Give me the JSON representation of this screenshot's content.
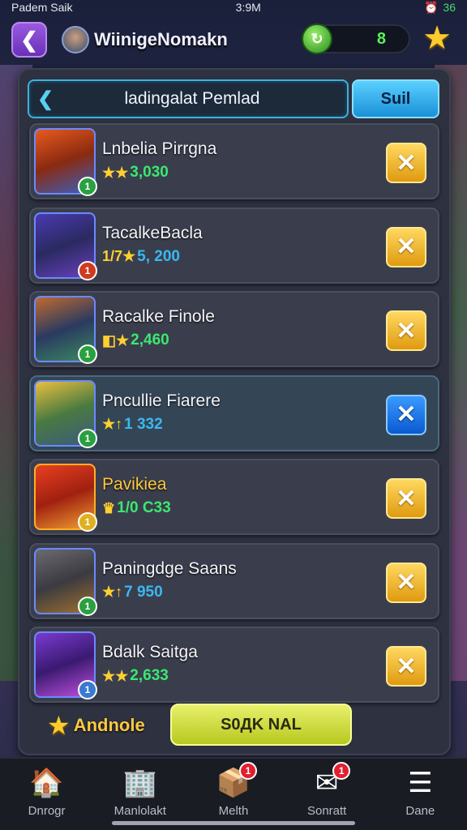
{
  "status_bar": {
    "carrier": "Padem Saik",
    "time": "3:9M",
    "right": "36"
  },
  "header": {
    "title": "WiinigeNomakn",
    "coins": "8"
  },
  "search": {
    "value": "ladingalat Pemlad",
    "button_label": "Suil"
  },
  "items": [
    {
      "name": "Lnbelia Pirrgna",
      "stat": "3,030",
      "badge": "1",
      "badge_color": "#2aa040",
      "stat_color": "#3ae870",
      "stat_icon": "★★",
      "avatar_bg": "linear-gradient(160deg,#e85a20,#8a2a10 50%,#3a60c0)",
      "action": "gold",
      "frame": "blue"
    },
    {
      "name": "TacalkeBacla",
      "stat": "5, 200",
      "badge": "1",
      "badge_color": "#d03a20",
      "stat_color": "#3ab8f0",
      "stat_icon": "1/7★",
      "avatar_bg": "linear-gradient(160deg,#4a3ab0,#2a2a60 50%,#6a40c0)",
      "action": "gold",
      "frame": "blue"
    },
    {
      "name": "Racalke Finole",
      "stat": "2,460",
      "badge": "1",
      "badge_color": "#2aa040",
      "stat_color": "#3ae870",
      "stat_icon": "◧★",
      "avatar_bg": "linear-gradient(160deg,#c06a30,#2a3a60 50%,#3a8a60)",
      "action": "gold",
      "frame": "blue"
    },
    {
      "name": "Pncullie Fiarere",
      "stat": "1 332",
      "badge": "1",
      "badge_color": "#2aa040",
      "stat_color": "#3ab8f0",
      "stat_icon": "★↑",
      "avatar_bg": "linear-gradient(160deg,#e8c040,#4a7a40 50%,#3a5a80)",
      "action": "blue",
      "frame": "blue"
    },
    {
      "name": "Pavikiea",
      "stat": "1/0 C33",
      "badge": "1",
      "badge_color": "#e0b020",
      "stat_color": "#3ae870",
      "stat_icon": "♛",
      "avatar_bg": "linear-gradient(160deg,#e84020,#a02010 50%,#f0a030)",
      "action": "gold",
      "frame": "gold",
      "name_gold": true
    },
    {
      "name": "Paningdge Saans",
      "stat": "7 950",
      "badge": "1",
      "badge_color": "#2aa040",
      "stat_color": "#3ab8f0",
      "stat_icon": "★↑",
      "avatar_bg": "linear-gradient(160deg,#6a6a70,#3a3a40 50%,#a07030)",
      "action": "gold",
      "frame": "blue"
    },
    {
      "name": "Bdalk Saitga",
      "stat": "2,633",
      "badge": "1",
      "badge_color": "#3a7ad0",
      "stat_color": "#3ae870",
      "stat_icon": "★★",
      "avatar_bg": "linear-gradient(160deg,#7a3ad0,#3a1a70 50%,#c050e0)",
      "action": "gold",
      "frame": "blue"
    }
  ],
  "footer": {
    "label": "Andnole",
    "button_label": "S0ДK NAL"
  },
  "nav": [
    {
      "label": "Dnrogr",
      "icon": "🏠",
      "badge": ""
    },
    {
      "label": "Manlolakt",
      "icon": "🏢",
      "badge": ""
    },
    {
      "label": "Melth",
      "icon": "📦",
      "badge": "1"
    },
    {
      "label": "Sonratt",
      "icon": "✉",
      "badge": "1"
    },
    {
      "label": "Dane",
      "icon": "☰",
      "badge": ""
    }
  ],
  "colors": {
    "accent_purple": "#9a5ae0",
    "accent_blue": "#3ab0e0",
    "gold": "#ffc840",
    "coin_green": "#5af05a"
  }
}
